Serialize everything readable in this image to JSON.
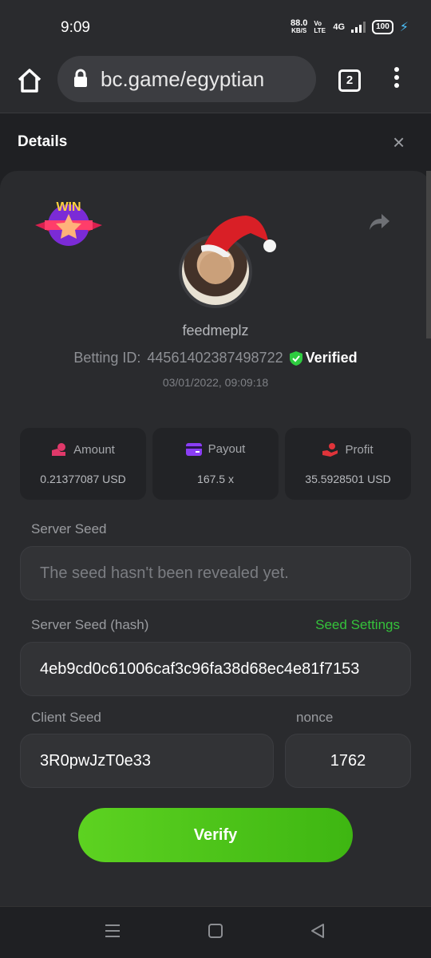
{
  "status": {
    "time": "9:09",
    "speed_value": "88.0",
    "speed_unit": "KB/S",
    "network": "Vo LTE",
    "signal": "4G",
    "battery": "100"
  },
  "browser": {
    "url": "bc.game/egyptian",
    "tab_count": "2"
  },
  "header": {
    "title": "Details",
    "close_label": "×"
  },
  "badge": {
    "text": "WIN"
  },
  "profile": {
    "username": "feedmeplz",
    "betting_id_label": "Betting ID:",
    "betting_id": "44561402387498722",
    "verified_label": "Verified",
    "date": "03/01/2022, 09:09:18"
  },
  "stats": [
    {
      "label": "Amount",
      "value": "0.21377087 USD",
      "icon": "coins-icon",
      "color": "#e0396a"
    },
    {
      "label": "Payout",
      "value": "167.5 x",
      "icon": "card-icon",
      "color": "#8b3ef5"
    },
    {
      "label": "Profit",
      "value": "35.5928501 USD",
      "icon": "hand-icon",
      "color": "#e0343a"
    }
  ],
  "server_seed": {
    "label": "Server Seed",
    "value": "The seed hasn't been revealed yet."
  },
  "server_seed_hash": {
    "label": "Server Seed (hash)",
    "settings_link": "Seed Settings",
    "value": "4eb9cd0c61006caf3c96fa38d68ec4e81f7153"
  },
  "client_seed": {
    "label": "Client Seed",
    "value": "3R0pwJzT0e33"
  },
  "nonce": {
    "label": "nonce",
    "value": "1762"
  },
  "verify_button": {
    "label": "Verify"
  },
  "colors": {
    "accent_green": "#3fbf1a",
    "verified_green": "#2ecc40"
  }
}
